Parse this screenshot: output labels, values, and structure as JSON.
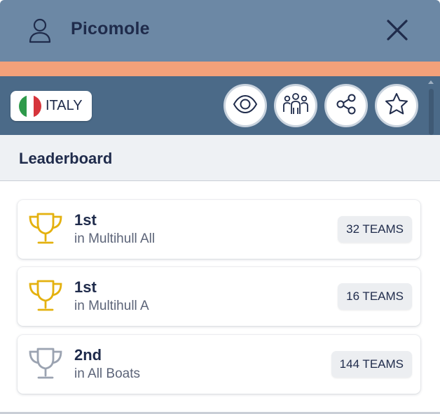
{
  "header": {
    "title": "Picomole",
    "user_icon": "user-icon",
    "close_icon": "close-icon",
    "background_color": "#6c88a5",
    "accent_color": "#f3a17a"
  },
  "toolbar": {
    "country": {
      "name": "ITALY",
      "flag_icon": "italy-flag-icon",
      "flag_colors": [
        "#2e9a4a",
        "#ffffff",
        "#d6343b"
      ]
    },
    "actions": [
      {
        "name": "watch",
        "icon": "eye-icon"
      },
      {
        "name": "crew",
        "icon": "team-icon"
      },
      {
        "name": "share",
        "icon": "share-icon"
      },
      {
        "name": "favorite",
        "icon": "star-icon"
      }
    ],
    "background_color": "#4b6a88"
  },
  "leaderboard": {
    "title": "Leaderboard",
    "entries": [
      {
        "rank": "1st",
        "category": "in Multihull All",
        "teams": "32 TEAMS",
        "trophy": "gold",
        "trophy_color": "#e4b10f"
      },
      {
        "rank": "1st",
        "category": "in Multihull A",
        "teams": "16 TEAMS",
        "trophy": "gold",
        "trophy_color": "#e4b10f"
      },
      {
        "rank": "2nd",
        "category": "in All Boats",
        "teams": "144 TEAMS",
        "trophy": "silver",
        "trophy_color": "#9ba3b1"
      }
    ]
  }
}
